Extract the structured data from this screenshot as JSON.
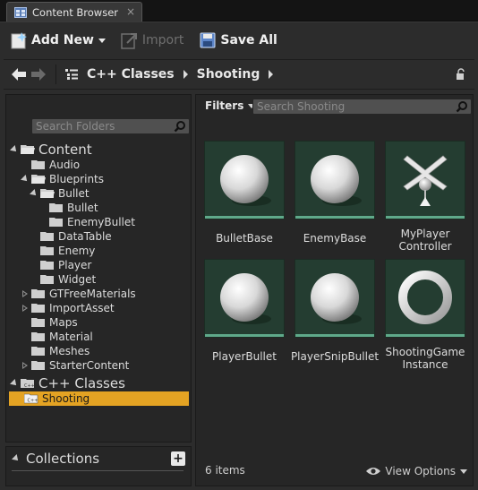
{
  "tab": {
    "title": "Content Browser",
    "close": "×"
  },
  "toolbar": {
    "add_new": "Add New",
    "import": "Import",
    "save_all": "Save All"
  },
  "path": {
    "crumbs": [
      "C++ Classes",
      "Shooting"
    ]
  },
  "folders": {
    "search_placeholder": "Search Folders",
    "tree": [
      {
        "label": "Content"
      },
      {
        "label": "Audio"
      },
      {
        "label": "Blueprints"
      },
      {
        "label": "Bullet"
      },
      {
        "label": "Bullet"
      },
      {
        "label": "EnemyBullet"
      },
      {
        "label": "DataTable"
      },
      {
        "label": "Enemy"
      },
      {
        "label": "Player"
      },
      {
        "label": "Widget"
      },
      {
        "label": "GTFreeMaterials"
      },
      {
        "label": "ImportAsset"
      },
      {
        "label": "Maps"
      },
      {
        "label": "Material"
      },
      {
        "label": "Meshes"
      },
      {
        "label": "StarterContent"
      },
      {
        "label": "C++ Classes"
      },
      {
        "label": "Shooting"
      }
    ]
  },
  "collections": {
    "label": "Collections",
    "add": "+"
  },
  "assets": {
    "filters_label": "Filters",
    "search_placeholder": "Search Shooting",
    "items": [
      {
        "label": "BulletBase",
        "icon": "sphere-thumbnail-icon"
      },
      {
        "label": "EnemyBase",
        "icon": "sphere-thumbnail-icon"
      },
      {
        "label": "MyPlayer\nController",
        "icon": "player-controller-thumbnail-icon"
      },
      {
        "label": "PlayerBullet",
        "icon": "sphere-thumbnail-icon"
      },
      {
        "label": "PlayerSnipBullet",
        "icon": "sphere-thumbnail-icon"
      },
      {
        "label": "ShootingGame\nInstance",
        "icon": "ring-thumbnail-icon"
      }
    ],
    "count": "6 items",
    "view_options": "View Options"
  },
  "colors": {
    "selection": "#e4a323",
    "thumb_bg": "#243d31",
    "thumb_bar": "#5fa98a"
  }
}
